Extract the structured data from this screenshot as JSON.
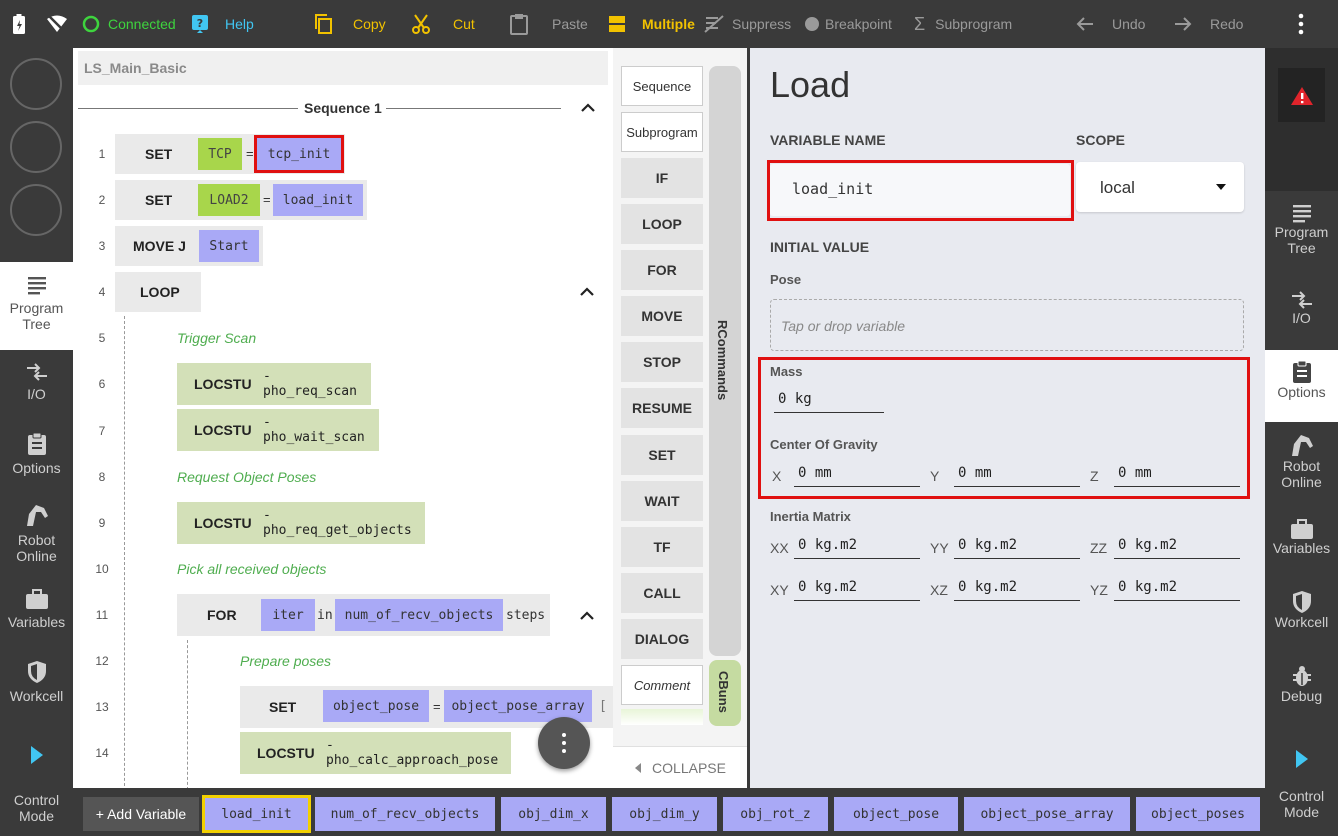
{
  "toolbar": {
    "connected": "Connected",
    "help": "Help",
    "copy": "Copy",
    "cut": "Cut",
    "paste": "Paste",
    "multiple": "Multiple",
    "suppress": "Suppress",
    "breakpoint": "Breakpoint",
    "subprogram": "Subprogram",
    "undo": "Undo",
    "redo": "Redo"
  },
  "left_nav": {
    "program_tree": "Program Tree",
    "io": "I/O",
    "options": "Options",
    "robot_online": "Robot Online",
    "variables": "Variables",
    "workcell": "Workcell",
    "control_mode": "Control Mode"
  },
  "right_nav": {
    "program_tree": "Program Tree",
    "io": "I/O",
    "options": "Options",
    "robot_online": "Robot Online",
    "variables": "Variables",
    "workcell": "Workcell",
    "debug": "Debug",
    "control_mode": "Control Mode"
  },
  "program": {
    "name": "LS_Main_Basic",
    "sequence_label": "Sequence 1",
    "lines": {
      "l1": {
        "num": "1",
        "kw": "SET",
        "a": "TCP",
        "eq": "=",
        "b": "tcp_init"
      },
      "l2": {
        "num": "2",
        "kw": "SET",
        "a": "LOAD2",
        "eq": "=",
        "b": "load_init"
      },
      "l3": {
        "num": "3",
        "kw": "MOVE J",
        "a": "Start"
      },
      "l4": {
        "num": "4",
        "kw": "LOOP"
      },
      "l5": {
        "num": "5",
        "comment": "Trigger Scan"
      },
      "l6": {
        "num": "6",
        "kw": "LOCSTU",
        "arg": "- pho_req_scan"
      },
      "l7": {
        "num": "7",
        "kw": "LOCSTU",
        "arg": "- pho_wait_scan"
      },
      "l8": {
        "num": "8",
        "comment": "Request Object Poses"
      },
      "l9": {
        "num": "9",
        "kw": "LOCSTU",
        "arg": "- pho_req_get_objects"
      },
      "l10": {
        "num": "10",
        "comment": "Pick all received objects"
      },
      "l11": {
        "num": "11",
        "kw": "FOR",
        "a": "iter",
        "in": "in",
        "b": "num_of_recv_objects",
        "steps": "steps"
      },
      "l12": {
        "num": "12",
        "comment": "Prepare poses"
      },
      "l13": {
        "num": "13",
        "kw": "SET",
        "a": "object_pose",
        "eq": "=",
        "b": "object_pose_array",
        "bracket": "["
      },
      "l14": {
        "num": "14",
        "kw": "LOCSTU",
        "arg": "- pho_calc_approach_pose"
      }
    }
  },
  "commands": {
    "sequence": "Sequence",
    "subprogram": "Subprogram",
    "if": "IF",
    "loop": "LOOP",
    "for": "FOR",
    "move": "MOVE",
    "stop": "STOP",
    "resume": "RESUME",
    "set": "SET",
    "wait": "WAIT",
    "tf": "TF",
    "call": "CALL",
    "dialog": "DIALOG",
    "comment": "Comment",
    "rail_commands": "RCommands",
    "rail_cbuns": "CBuns",
    "collapse": "COLLAPSE"
  },
  "properties": {
    "title": "Load",
    "variable_name_label": "VARIABLE NAME",
    "variable_name_value": "load_init",
    "scope_label": "SCOPE",
    "scope_value": "local",
    "initial_value_label": "INITIAL VALUE",
    "pose_label": "Pose",
    "pose_placeholder": "Tap or drop variable",
    "mass_label": "Mass",
    "mass_value": "0  kg",
    "cog_label": "Center Of Gravity",
    "cog": {
      "x_label": "X",
      "x": "0  mm",
      "y_label": "Y",
      "y": "0  mm",
      "z_label": "Z",
      "z": "0  mm"
    },
    "inertia_label": "Inertia Matrix",
    "inertia": {
      "xx_label": "XX",
      "xx": "0  kg.m2",
      "yy_label": "YY",
      "yy": "0  kg.m2",
      "zz_label": "ZZ",
      "zz": "0  kg.m2",
      "xy_label": "XY",
      "xy": "0  kg.m2",
      "xz_label": "XZ",
      "xz": "0  kg.m2",
      "yz_label": "YZ",
      "yz": "0  kg.m2"
    }
  },
  "bottom": {
    "add_variable": "+ Add Variable",
    "chips": {
      "c0": "load_init",
      "c1": "num_of_recv_objects",
      "c2": "obj_dim_x",
      "c3": "obj_dim_y",
      "c4": "obj_rot_z",
      "c5": "object_pose",
      "c6": "object_pose_array",
      "c7": "object_poses"
    }
  },
  "colors": {
    "accent_yellow": "#f2c200",
    "connected_green": "#3ed43e",
    "help_blue": "#41c6f2",
    "variable_purple": "#a9a9f6",
    "type_lime": "#a8d64b",
    "comment_green": "#4fad4f",
    "highlight_red": "#e01010"
  }
}
